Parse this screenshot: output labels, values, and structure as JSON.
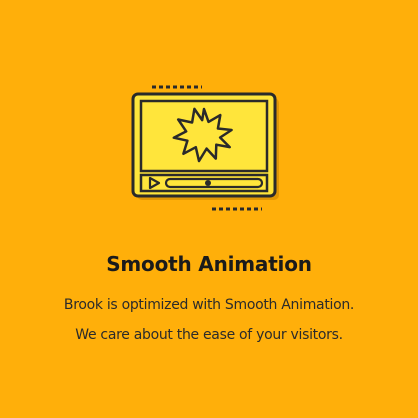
{
  "feature": {
    "icon": "video-player-icon",
    "title": "Smooth Animation",
    "description_lines": [
      "Brook is optimized with Smooth Animation.",
      "We care about the ease of your visitors."
    ]
  },
  "colors": {
    "background": "#FFAF0A",
    "icon_fill": "#FFE53B",
    "icon_stroke": "#2A2A2A",
    "title": "#1B1B1B",
    "text": "#2B2B2B"
  }
}
